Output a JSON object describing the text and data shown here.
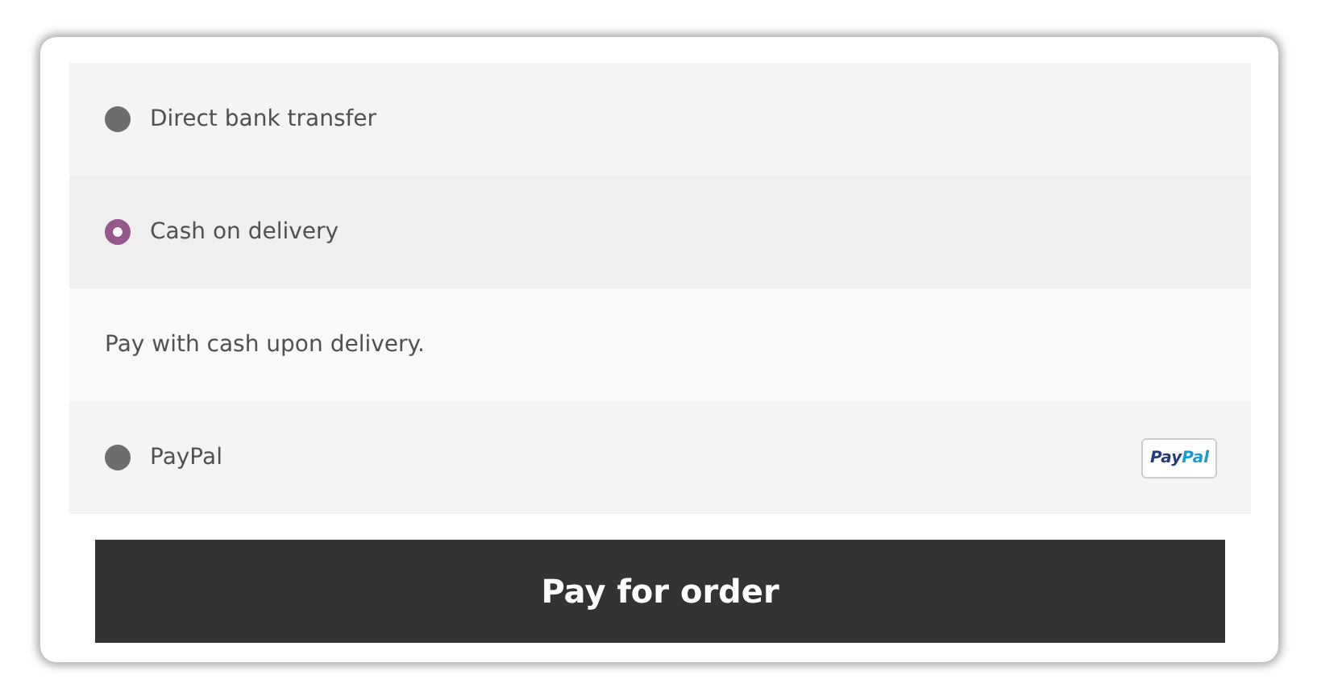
{
  "payment_methods": [
    {
      "label": "Direct bank transfer",
      "selected": false
    },
    {
      "label": "Cash on delivery",
      "selected": true,
      "description": "Pay with cash upon delivery."
    },
    {
      "label": "PayPal",
      "selected": false,
      "logo": [
        {
          "text": "Pay",
          "color": "#253b80"
        },
        {
          "text": "Pal",
          "color": "#179bd7"
        }
      ]
    }
  ],
  "submit_button": "Pay for order"
}
